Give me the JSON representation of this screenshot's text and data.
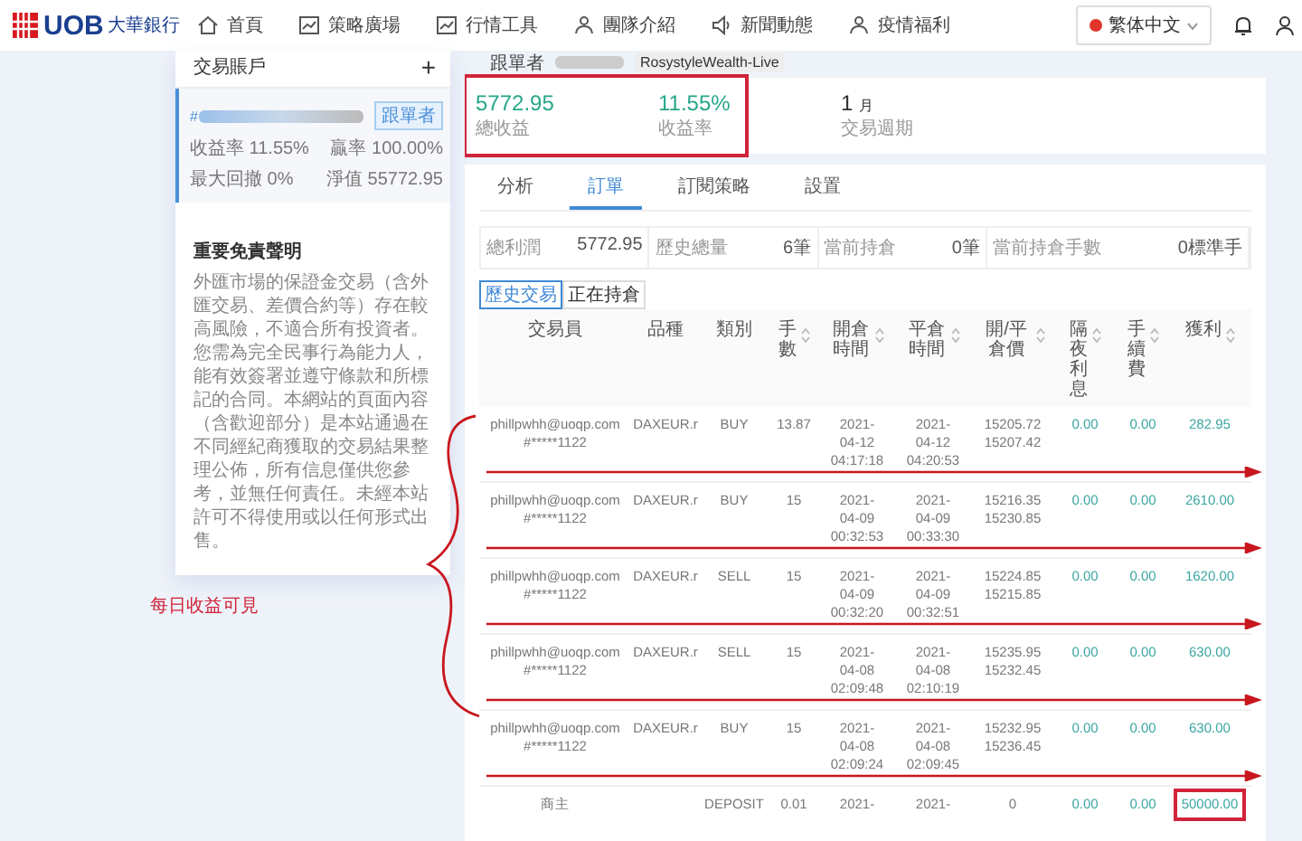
{
  "header": {
    "logo": {
      "text": "UOB",
      "subtitle": "大華銀行"
    },
    "nav": [
      {
        "label": "首頁",
        "kind": "home"
      },
      {
        "label": "策略廣場",
        "kind": "chart"
      },
      {
        "label": "行情工具",
        "kind": "chart"
      },
      {
        "label": "團隊介紹",
        "kind": "team"
      },
      {
        "label": "新聞動態",
        "kind": "speaker"
      },
      {
        "label": "疫情福利",
        "kind": "team"
      }
    ],
    "language": "繁体中文"
  },
  "sidebar": {
    "title": "交易賬戶",
    "add": "+",
    "account": {
      "number": "#",
      "selected": true,
      "tag": "跟單者",
      "stats": [
        {
          "label": "收益率",
          "value": "11.55%"
        },
        {
          "label": "贏率",
          "value": "100.00%"
        },
        {
          "label": "最大回撤",
          "value": "0%"
        },
        {
          "label": "淨值",
          "value": "55772.95"
        }
      ]
    },
    "disclaimer": {
      "title": "重要免責聲明",
      "text": "外匯市場的保證金交易（含外匯交易、差價合約等）存在較高風險，不適合所有投資者。您需為完全民事行為能力人，能有效簽署並遵守條款和所標記的合同。本網站的頁面內容（含歡迎部分）是本站通過在不同經紀商獲取的交易結果整理公佈，所有信息僅供您參考，並無任何責任。未經本站許可不得使用或以任何形式出售。"
    }
  },
  "follower": {
    "label": "跟單者",
    "account": "RosystyleWealth-Live"
  },
  "stats": {
    "highlighted": true,
    "items": [
      {
        "value": "5772.95",
        "label": "總收益",
        "kind": "money"
      },
      {
        "value": "11.55%",
        "label": "收益率",
        "kind": "money"
      },
      {
        "value": "1",
        "unit": "月",
        "label": "交易週期",
        "kind": "period"
      }
    ]
  },
  "tabs": [
    {
      "label": "分析",
      "selected": false
    },
    {
      "label": "訂單",
      "selected": true
    },
    {
      "label": "訂閱策略",
      "selected": false
    },
    {
      "label": "設置",
      "selected": false
    }
  ],
  "summary": [
    {
      "label": "總利潤",
      "value": "5772.95"
    },
    {
      "label": "歷史總量",
      "value": "6筆"
    },
    {
      "label": "當前持倉",
      "value": "0筆"
    },
    {
      "label": "當前持倉手數",
      "value": "0標準手"
    }
  ],
  "subtabs": [
    {
      "label": "歷史交易",
      "selected": true
    },
    {
      "label": "正在持倉",
      "selected": false
    }
  ],
  "annotation": {
    "text": "每日收益可見"
  },
  "table": {
    "columns": [
      {
        "label": "交易員",
        "sortable": false
      },
      {
        "label": "品種",
        "sortable": false
      },
      {
        "label": "類別",
        "sortable": false
      },
      {
        "label": "手數",
        "sortable": true
      },
      {
        "label": "開倉時間",
        "sortable": true
      },
      {
        "label": "平倉時間",
        "sortable": true
      },
      {
        "label": "開/平倉價",
        "sortable": true
      },
      {
        "label": "隔夜利息",
        "sortable": true
      },
      {
        "label": "手續費",
        "sortable": true
      },
      {
        "label": "獲利",
        "sortable": true
      }
    ],
    "rows": [
      {
        "trader": [
          "phillpwhh@uoqp.com",
          "#*****1122"
        ],
        "symbol": "DAXEUR.r",
        "type": "BUY",
        "lots": "13.87",
        "open": [
          "2021-",
          "04-12",
          "04:17:18"
        ],
        "close": [
          "2021-",
          "04-12",
          "04:20:53"
        ],
        "price": [
          "15205.72",
          "15207.42"
        ],
        "swap": "0.00",
        "fee": "0.00",
        "profit": "282.95",
        "underlined": true,
        "highlighted": false
      },
      {
        "trader": [
          "phillpwhh@uoqp.com",
          "#*****1122"
        ],
        "symbol": "DAXEUR.r",
        "type": "BUY",
        "lots": "15",
        "open": [
          "2021-",
          "04-09",
          "00:32:53"
        ],
        "close": [
          "2021-",
          "04-09",
          "00:33:30"
        ],
        "price": [
          "15216.35",
          "15230.85"
        ],
        "swap": "0.00",
        "fee": "0.00",
        "profit": "2610.00",
        "underlined": true,
        "highlighted": false
      },
      {
        "trader": [
          "phillpwhh@uoqp.com",
          "#*****1122"
        ],
        "symbol": "DAXEUR.r",
        "type": "SELL",
        "lots": "15",
        "open": [
          "2021-",
          "04-09",
          "00:32:20"
        ],
        "close": [
          "2021-",
          "04-09",
          "00:32:51"
        ],
        "price": [
          "15224.85",
          "15215.85"
        ],
        "swap": "0.00",
        "fee": "0.00",
        "profit": "1620.00",
        "underlined": true,
        "highlighted": false
      },
      {
        "trader": [
          "phillpwhh@uoqp.com",
          "#*****1122"
        ],
        "symbol": "DAXEUR.r",
        "type": "SELL",
        "lots": "15",
        "open": [
          "2021-",
          "04-08",
          "02:09:48"
        ],
        "close": [
          "2021-",
          "04-08",
          "02:10:19"
        ],
        "price": [
          "15235.95",
          "15232.45"
        ],
        "swap": "0.00",
        "fee": "0.00",
        "profit": "630.00",
        "underlined": true,
        "highlighted": false
      },
      {
        "trader": [
          "phillpwhh@uoqp.com",
          "#*****1122"
        ],
        "symbol": "DAXEUR.r",
        "type": "BUY",
        "lots": "15",
        "open": [
          "2021-",
          "04-08",
          "02:09:24"
        ],
        "close": [
          "2021-",
          "04-08",
          "02:09:45"
        ],
        "price": [
          "15232.95",
          "15236.45"
        ],
        "swap": "0.00",
        "fee": "0.00",
        "profit": "630.00",
        "underlined": true,
        "highlighted": false
      },
      {
        "trader": [
          "商主"
        ],
        "symbol": "",
        "type": "DEPOSIT",
        "lots": "0.01",
        "open": [
          "2021-"
        ],
        "close": [
          "2021-"
        ],
        "price": [
          "0"
        ],
        "swap": "0.00",
        "fee": "0.00",
        "profit": "50000.00",
        "underlined": false,
        "highlighted": true
      }
    ]
  }
}
